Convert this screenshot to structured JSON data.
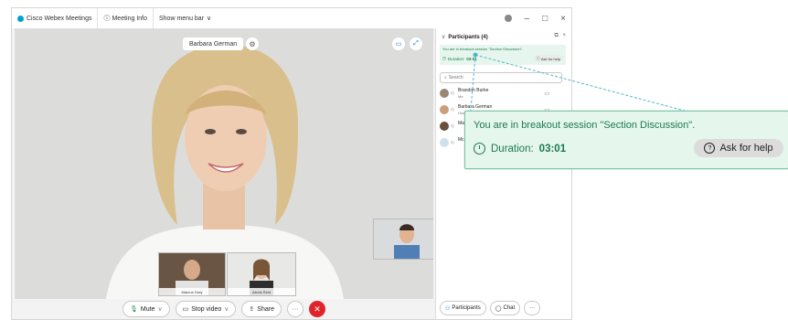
{
  "titlebar": {
    "app_title": "Cisco Webex Meetings",
    "meeting_info": "Meeting Info",
    "show_menu": "Show menu bar",
    "chevron": "∨",
    "minimize": "–",
    "maximize": "□",
    "close": "×"
  },
  "stage": {
    "active_speaker": "Barbara German",
    "thumbnails": [
      {
        "name": "Marcus Gray"
      },
      {
        "name": "Alexis Reid"
      }
    ]
  },
  "controls": {
    "mute": "Mute",
    "stop_video": "Stop video",
    "share": "Share",
    "more": "···",
    "end": "✕",
    "chevron": "∨"
  },
  "panel": {
    "header": "Participants (4)",
    "breakout_text": "You are in breakout session \"Section Discussion\".",
    "duration_label": "Duration:",
    "duration_value": "03:01",
    "ask_for_help": "Ask for help",
    "search_placeholder": "Search",
    "participants": [
      {
        "name": "Brandon Burke",
        "role": "Me"
      },
      {
        "name": "Barbara German",
        "role": "Host"
      },
      {
        "name": "Ma",
        "role": ""
      },
      {
        "name": "Mc",
        "role": ""
      }
    ],
    "bottom_participants": "Participants",
    "bottom_chat": "Chat",
    "bottom_more": "···"
  },
  "callout": {
    "text": "You are in breakout session \"Section Discussion\".",
    "duration_label": "Duration:",
    "duration_value": "03:01",
    "ask_for_help": "Ask for help"
  },
  "colors": {
    "accent_green": "#1c7a4c",
    "callout_bg": "#e5f6ed",
    "end_call": "#e0242b",
    "leader_line": "#52b6c9"
  }
}
